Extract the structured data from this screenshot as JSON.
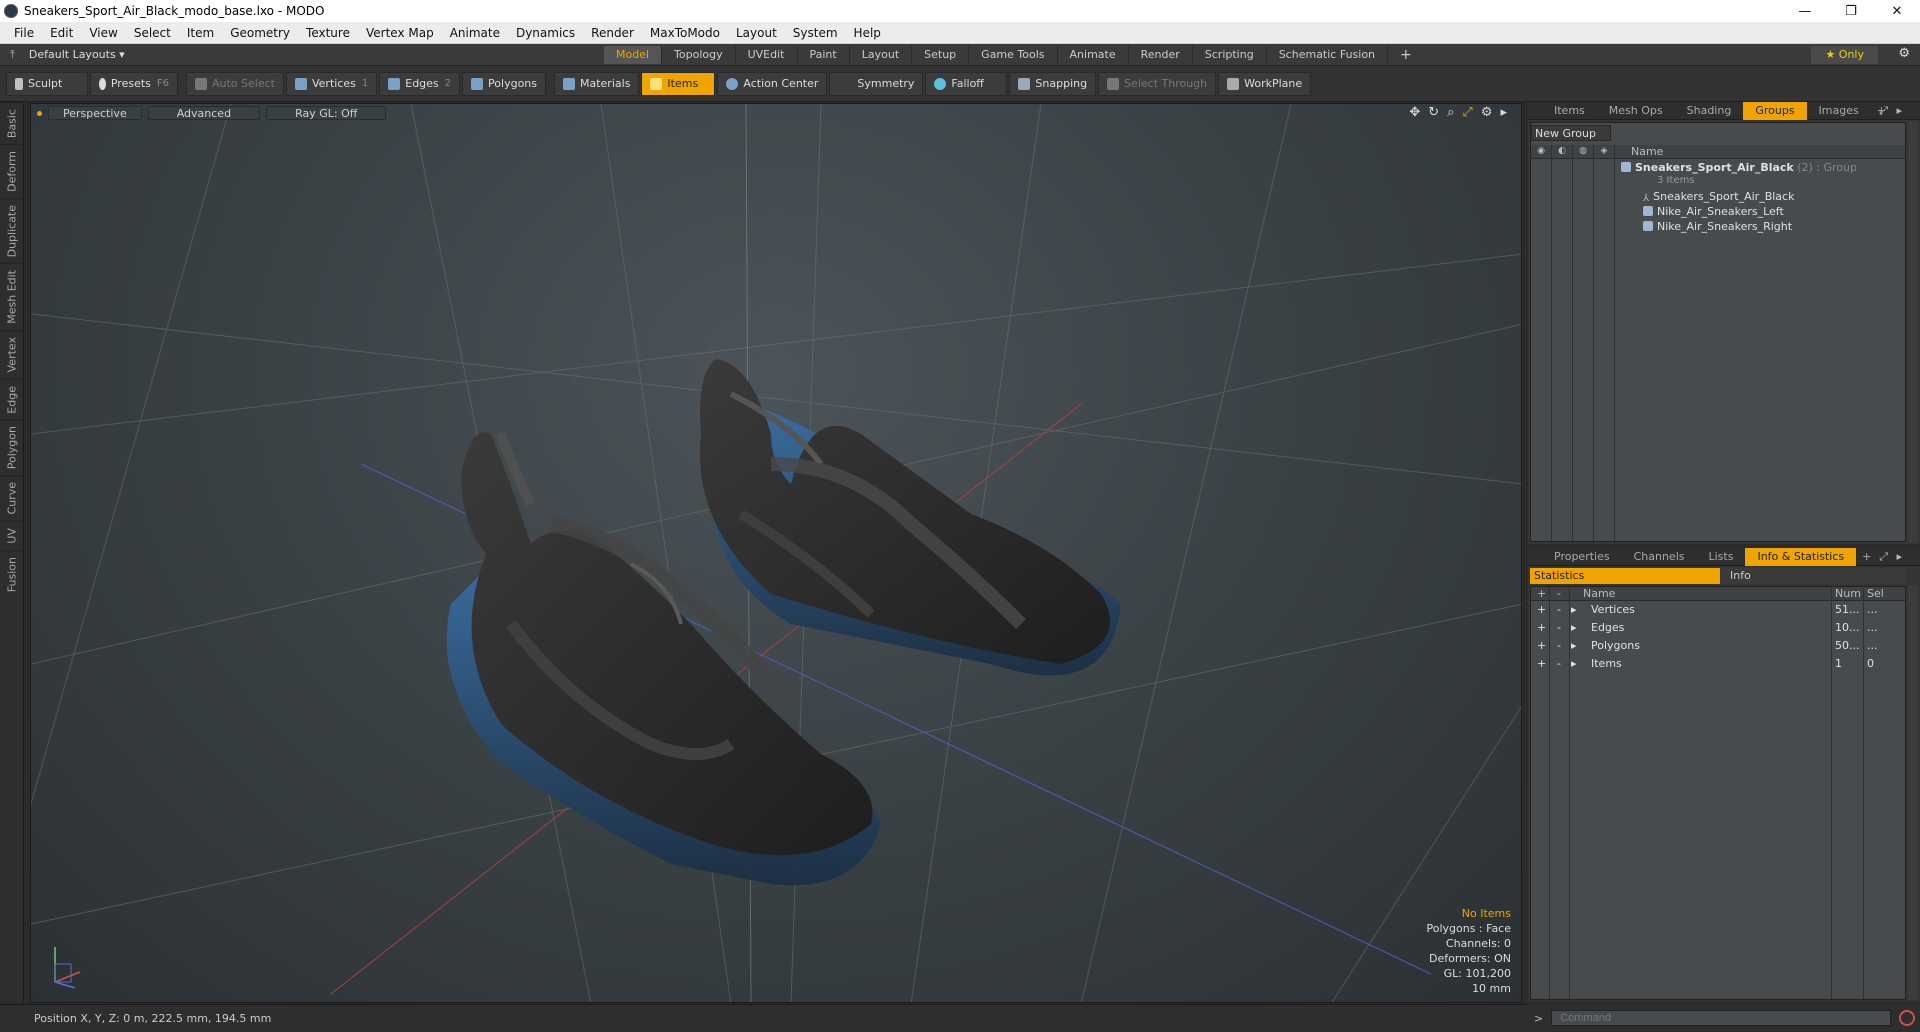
{
  "window": {
    "title": "Sneakers_Sport_Air_Black_modo_base.lxo - MODO",
    "minimize": "—",
    "maximize": "❐",
    "close": "✕"
  },
  "menu": [
    "File",
    "Edit",
    "View",
    "Select",
    "Item",
    "Geometry",
    "Texture",
    "Vertex Map",
    "Animate",
    "Dynamics",
    "Render",
    "MaxToModo",
    "Layout",
    "System",
    "Help"
  ],
  "layout_bar": {
    "layouts_label": "Default Layouts ▾",
    "tabs": [
      "Model",
      "Topology",
      "UVEdit",
      "Paint",
      "Layout",
      "Setup",
      "Game Tools",
      "Animate",
      "Render",
      "Scripting",
      "Schematic Fusion",
      "+"
    ],
    "active_tab": "Model",
    "only_label": "★  Only"
  },
  "toolbar": {
    "sculpt": "Sculpt",
    "presets": "Presets",
    "presets_key": "F6",
    "auto_select": "Auto Select",
    "vertices": "Vertices",
    "vertices_num": "1",
    "edges": "Edges",
    "edges_num": "2",
    "polygons": "Polygons",
    "materials": "Materials",
    "items": "Items",
    "action_center": "Action Center",
    "symmetry": "Symmetry",
    "falloff": "Falloff",
    "snapping": "Snapping",
    "select_through": "Select Through",
    "workplane": "WorkPlane"
  },
  "left_tabs": [
    "Basic",
    "Deform",
    "Duplicate",
    "Mesh Edit",
    "Vertex",
    "Edge",
    "Polygon",
    "Curve",
    "UV",
    "Fusion"
  ],
  "viewport": {
    "perspective": "Perspective",
    "advanced": "Advanced",
    "raygl": "Ray GL: Off",
    "info": {
      "no_items": "No Items",
      "polygons": "Polygons : Face",
      "channels": "Channels: 0",
      "deformers": "Deformers: ON",
      "gl": "GL: 101,200",
      "scale": "10 mm"
    }
  },
  "status": {
    "position": "Position X, Y, Z:  0 m, 222.5 mm, 194.5 mm"
  },
  "groups_panel": {
    "tabs": [
      "Items",
      "Mesh Ops",
      "Shading",
      "Groups",
      "Images",
      "+"
    ],
    "active_tab": "Groups",
    "new_group": "New Group",
    "name_header": "Name",
    "group_name": "Sneakers_Sport_Air_Black",
    "group_suffix": " (2) : Group",
    "group_count": "3 Items",
    "children": [
      "Sneakers_Sport_Air_Black",
      "Nike_Air_Sneakers_Left",
      "Nike_Air_Sneakers_Right"
    ]
  },
  "stats_panel": {
    "tabs": [
      "Properties",
      "Channels",
      "Lists",
      "Info & Statistics",
      "+"
    ],
    "active_tab": "Info & Statistics",
    "sub_statistics": "Statistics",
    "sub_info": "Info",
    "headers": {
      "plus": "+",
      "minus": "-",
      "name": "Name",
      "num": "Num",
      "sel": "Sel"
    },
    "rows": [
      {
        "name": "Vertices",
        "num": "51...",
        "sel": "..."
      },
      {
        "name": "Edges",
        "num": "10...",
        "sel": "..."
      },
      {
        "name": "Polygons",
        "num": "50...",
        "sel": "..."
      },
      {
        "name": "Items",
        "num": "1",
        "sel": "0"
      }
    ]
  },
  "command": {
    "placeholder": "Command",
    "prompt": ">"
  },
  "colors": {
    "accent": "#f0a400",
    "sole_blue": "#2e5f8f",
    "shoe_black": "#2a2a2a"
  }
}
